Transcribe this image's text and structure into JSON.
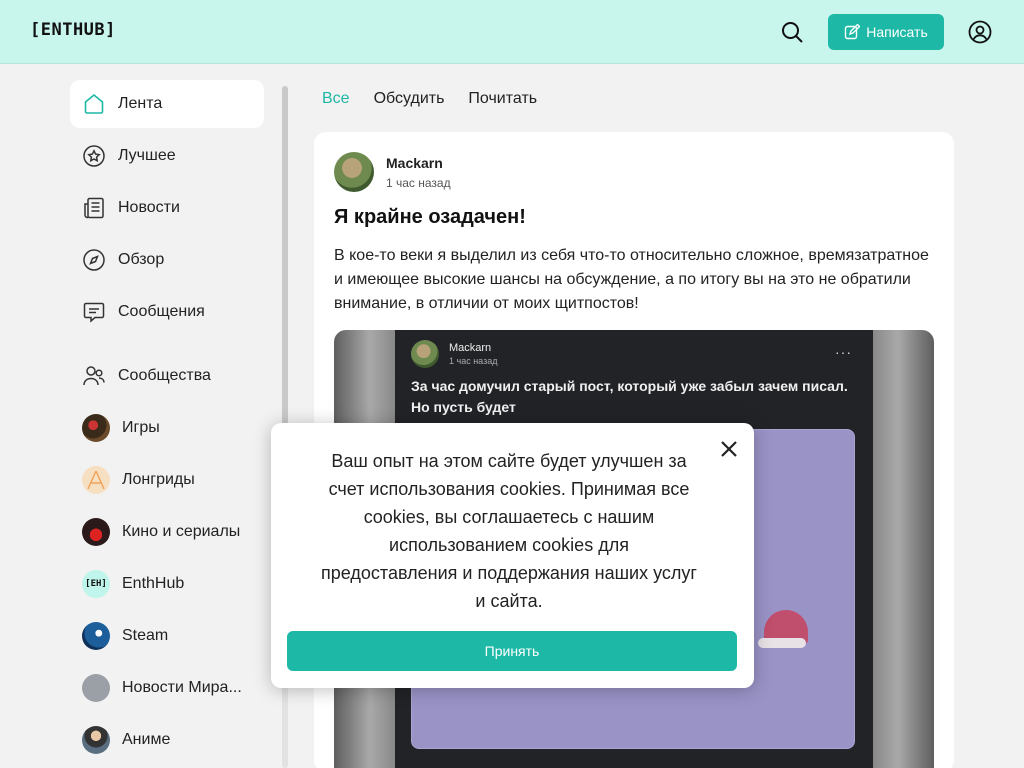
{
  "header": {
    "logo": "[ENTHUB]",
    "write_label": "Написать"
  },
  "sidebar": {
    "items": [
      {
        "label": "Лента",
        "icon": "home-icon",
        "active": true
      },
      {
        "label": "Лучшее",
        "icon": "star-icon"
      },
      {
        "label": "Новости",
        "icon": "newspaper-icon"
      },
      {
        "label": "Обзор",
        "icon": "compass-icon"
      },
      {
        "label": "Сообщения",
        "icon": "message-icon"
      }
    ],
    "communities_label": "Сообщества",
    "communities": [
      {
        "label": "Игры"
      },
      {
        "label": "Лонгриды"
      },
      {
        "label": "Кино и сериалы"
      },
      {
        "label": "EnthHub",
        "badge": "[EH]"
      },
      {
        "label": "Steam"
      },
      {
        "label": "Новости Мира..."
      },
      {
        "label": "Аниме"
      }
    ]
  },
  "tabs": [
    "Все",
    "Обсудить",
    "Почитать"
  ],
  "post": {
    "author": "Mackarn",
    "time": "1 час назад",
    "title": "Я крайне озадачен!",
    "text": "В кое-то веки я выделил из себя что-то относительно сложное, времязатратное и имеющее высокие шансы на обсуждение, а по итогу вы на это не обратили внимание, в отличии от моих щитпостов!",
    "screenshot": {
      "author": "Mackarn",
      "time": "1 час назад",
      "dots": "···",
      "text": "За час домучил старый пост, который уже забыл зачем писал. Но пусть будет"
    }
  },
  "cookie": {
    "text": "Ваш опыт на этом сайте будет улучшен за счет использования cookies. Принимая все cookies, вы соглашаетесь с нашим использованием cookies для предоставления и поддержания наших услуг и сайта.",
    "accept_label": "Принять"
  },
  "colors": {
    "accent": "#1db8a6",
    "header_bg": "#c8f5ec",
    "page_bg": "#f2f2f2"
  }
}
